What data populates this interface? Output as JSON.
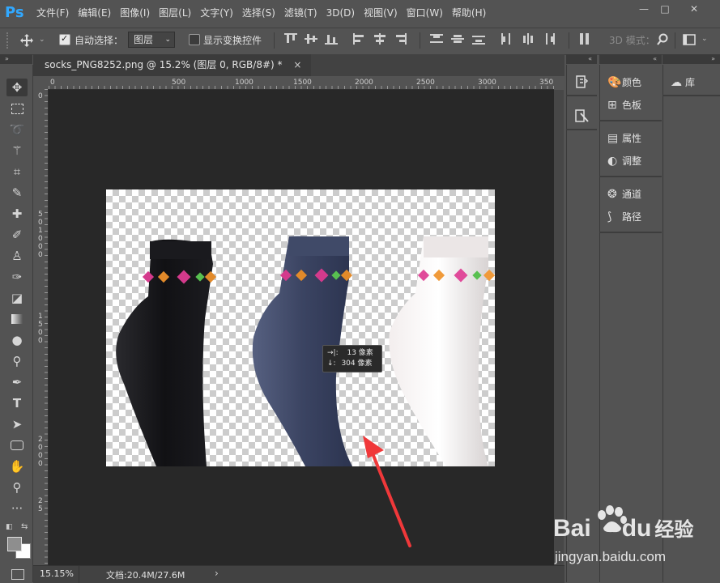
{
  "app": {
    "logo": "Ps",
    "menu": [
      "文件(F)",
      "编辑(E)",
      "图像(I)",
      "图层(L)",
      "文字(Y)",
      "选择(S)",
      "滤镜(T)",
      "3D(D)",
      "视图(V)",
      "窗口(W)",
      "帮助(H)"
    ],
    "window_controls": [
      "—",
      "□",
      "✕"
    ]
  },
  "options_bar": {
    "auto_select_label": "自动选择：",
    "auto_select_checked": true,
    "auto_select_target": "图层",
    "show_transform_label": "显示变换控件",
    "show_transform_checked": false,
    "mode_3d_label": "3D 模式："
  },
  "document": {
    "tab_title": "socks_PNG8252.png @ 15.2% (图层 0, RGB/8#) *",
    "tab_close": "×",
    "ruler_top_labels": [
      "0",
      "500",
      "1000",
      "1500",
      "2000",
      "2500",
      "3000",
      "350"
    ],
    "ruler_left_labels": [
      "0",
      "5",
      "0",
      "1",
      "0",
      "0",
      "0",
      "1",
      "5",
      "0",
      "0",
      "2",
      "0",
      "0",
      "0",
      "2",
      "5"
    ],
    "tooltip": {
      "line1_icon": "→|:",
      "line1_value": "13 像素",
      "line2_icon": "↓:",
      "line2_value": "304 像素"
    }
  },
  "status": {
    "zoom": "15.15%",
    "doc_info": "文档:20.4M/27.6M",
    "arrow": "›"
  },
  "panels": {
    "group1": [
      {
        "icon": "palette-icon",
        "label": "颜色"
      },
      {
        "icon": "grid-icon",
        "label": "色板"
      }
    ],
    "group2": [
      {
        "icon": "properties-icon",
        "label": "属性"
      },
      {
        "icon": "adjustments-icon",
        "label": "调整"
      }
    ],
    "group3": [
      {
        "icon": "channels-icon",
        "label": "通道"
      },
      {
        "icon": "paths-icon",
        "label": "路径"
      }
    ],
    "library_label": "库"
  },
  "watermark": {
    "brand": "Bai",
    "brand2": "du",
    "brand_cn": "经验",
    "url": "jingyan.baidu.com"
  },
  "colors": {
    "bg": "#535353",
    "canvas": "#282828",
    "accent": "#31a8ff",
    "arrow": "#f0383a"
  }
}
